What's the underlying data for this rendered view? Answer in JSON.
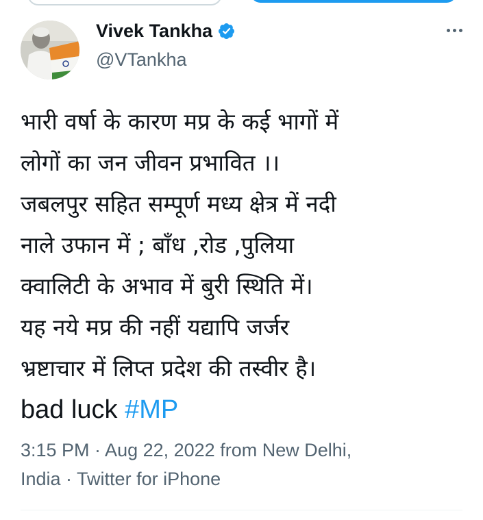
{
  "author": {
    "display_name": "Vivek Tankha",
    "handle": "@VTankha",
    "verified": true,
    "avatar_icon": "profile-photo-with-indian-flag"
  },
  "tweet": {
    "lines": [
      "भारी वर्षा के कारण मप्र के कई भागों में",
      "लोगों का जन जीवन प्रभावित ।।",
      "जबलपुर सहित सम्पूर्ण मध्य क्षेत्र में नदी",
      "नाले उफान में ; बाँध ,रोड ,पुलिया",
      "क्वालिटी के अभाव में बुरी स्थिति में।",
      "यह नये मप्र की नहीं यद्यापि जर्जर",
      "भ्रष्टाचार में लिप्त प्रदेश की तस्वीर है।"
    ],
    "last_line_text": "bad luck ",
    "hashtag": "#MP"
  },
  "meta": {
    "line1": "3:15 PM · Aug 22, 2022 from New Delhi,",
    "line2": "India · Twitter for iPhone"
  },
  "icons": {
    "verified": "verified-badge-icon",
    "more": "more-options-icon"
  },
  "colors": {
    "link": "#1d9bf0",
    "secondary_text": "#536471",
    "primary_text": "#0f1419",
    "verified_badge": "#1d9bf0"
  }
}
